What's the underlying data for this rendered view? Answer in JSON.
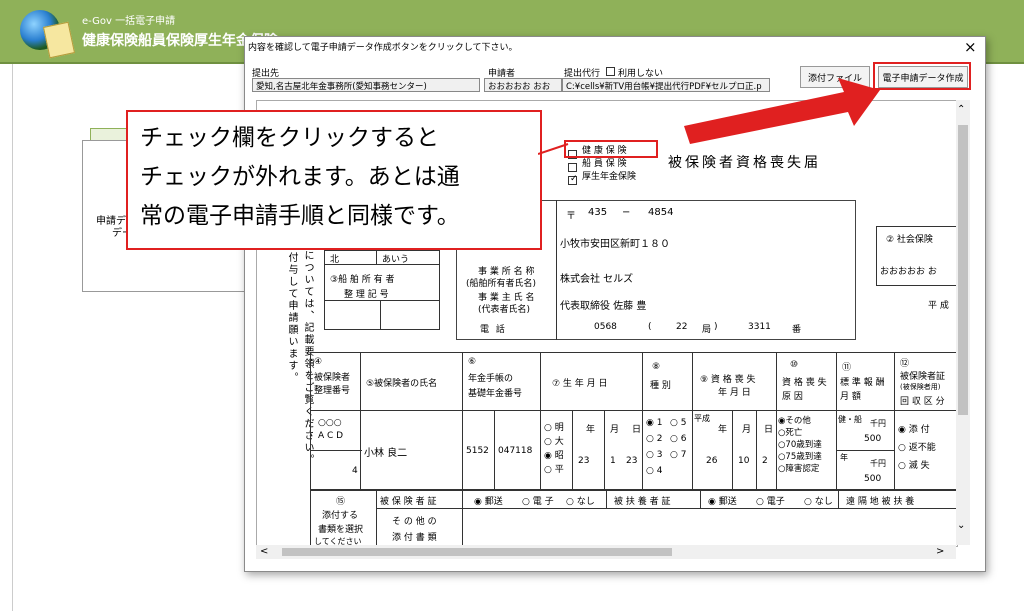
{
  "app": {
    "name_small": "e-Gov 一括電子申請",
    "title": "健康保険船員保険厚生年金保険"
  },
  "bg_panel": {
    "line1": "申請デ",
    "line2": "デー"
  },
  "dialog": {
    "instruction": "内容を確認して電子申請データ作成ボタンをクリックして下さい。",
    "close": "×",
    "submit_to_label": "提出先",
    "submit_to_value": "愛知,名古屋北年金事務所(愛知事務センター)",
    "applicant_label": "申請者",
    "applicant_value": "おおおおお おお",
    "proxy_label": "提出代行",
    "proxy_option": "利用しない",
    "path_value": "C:¥cells¥新TV用台帳¥提出代行PDF¥セルプロ正.p",
    "attach_button": "添付ファイル",
    "create_button": "電子申請データ作成"
  },
  "form": {
    "insurance_options": [
      "健 康 保 険",
      "船 員 保 険",
      "厚生年金保険"
    ],
    "insurance_checked": [
      false,
      false,
      true
    ],
    "form_title": "被保険者資格喪失届",
    "postal_mark": "〒",
    "postal1": "435",
    "postal_dash": "−",
    "postal2": "4854",
    "address": "小牧市安田区新町１８０",
    "office_name_label_1": "事 業 所 名 称",
    "office_name_label_2": "(船舶所有者氏名)",
    "owner_label_1": "事 業 主 氏 名",
    "owner_label_2": "(代表者氏名)",
    "office_name": "株式会社 セルズ",
    "owner_name": "代表取締役 佐藤 豊",
    "phone_label": "電 話",
    "phone1": "0568",
    "phone2": "22",
    "phone_bureau": "局",
    "phone3": "3311",
    "phone_ban": "番",
    "paren_open": "(",
    "paren_close": ")",
    "social_label": "② 社会保険",
    "social_value": "おおおおお お",
    "pref_label": "平 成",
    "area_value": "北",
    "area_kana": "あいう",
    "ship_label_1": "③船 舶 所 有 者",
    "ship_label_2": "整 理 記 号",
    "vertical_notice": "については、記載要領をご覧ください。",
    "vertical_notice2": "名を付与して申請願います。",
    "col4_num": "④",
    "col4_label_1": "被保険者",
    "col4_label_2": "整理番号",
    "col5_label": "⑤被保険者の氏名",
    "col6_num": "⑥",
    "col6_label_1": "年金手帳の",
    "col6_label_2": "基礎年金番号",
    "col7_label": "⑦ 生 年 月 日",
    "col8_num": "⑧",
    "col8_label": "種 別",
    "col9_label_1": "⑨ 資 格 喪 失",
    "col9_label_2": "年 月 日",
    "col10_num": "⑩",
    "col10_label_1": "資 格 喪 失",
    "col10_label_2": "原 因",
    "col11_num": "⑪",
    "col11_label_1": "標 準 報 酬",
    "col11_label_2": "月 額",
    "col12_num": "⑫",
    "col12_label_1": "被保険者証",
    "col12_label_2": "(被保険者用)",
    "col12_label_3": "回 収 区 分",
    "row_abc_top": "○○○",
    "row_abc_bottom": "A C D",
    "row_number": "4",
    "person_name": "小林 良二",
    "pension1": "5152",
    "pension2": "047118",
    "era_options": [
      "明",
      "大",
      "昭",
      "平"
    ],
    "era_checked": [
      false,
      false,
      true,
      false
    ],
    "birth_year": "23",
    "birth_month": "1",
    "birth_day": "23",
    "ymd": [
      "年",
      "月",
      "日"
    ],
    "type_options": [
      "1",
      "2",
      "3",
      "4",
      "5",
      "6",
      "7"
    ],
    "type_checked": [
      true,
      false,
      false,
      false,
      false,
      false,
      false
    ],
    "loss_era": "平成",
    "loss_year": "26",
    "loss_month": "10",
    "loss_day": "2",
    "reason_options": [
      "その他",
      "死亡",
      "70歳到達",
      "75歳到達",
      "障害認定"
    ],
    "reason_checked": [
      true,
      false,
      false,
      false,
      false
    ],
    "salary_label_1": "健・船",
    "salary_unit": "千円",
    "salary_value_1": "500",
    "salary_label_2": "年",
    "salary_value_2": "500",
    "return_options": [
      "添 付",
      "返不能",
      "滅 失"
    ],
    "return_checked": [
      true,
      false,
      false
    ],
    "col15_num": "⑮",
    "col15_label_1": "添付する",
    "col15_label_2": "書類を選択",
    "col15_label_3": "してください",
    "cert_label": "被 保 険 者 証",
    "cert_options": [
      "郵送",
      "電 子",
      "なし"
    ],
    "cert_checked": [
      true,
      false,
      false
    ],
    "dep_label": "被 扶 養 者 証",
    "dep_options": [
      "郵送",
      "電子",
      "なし"
    ],
    "dep_checked": [
      true,
      false,
      false
    ],
    "remote_label": "遠 隔 地 被 扶 養",
    "other_label_1": "そ の 他 の",
    "other_label_2": "添 付 書 類"
  },
  "callout": {
    "line1": "チェック欄をクリックすると",
    "line2": "チェックが外れます。あとは通",
    "line3": "常の電子申請手順と同様です。"
  },
  "scroll": {
    "up": "⌃",
    "down": "⌄",
    "left": "<",
    "right": ">"
  },
  "colors": {
    "header": "#8fb159",
    "highlight": "#e02020"
  }
}
